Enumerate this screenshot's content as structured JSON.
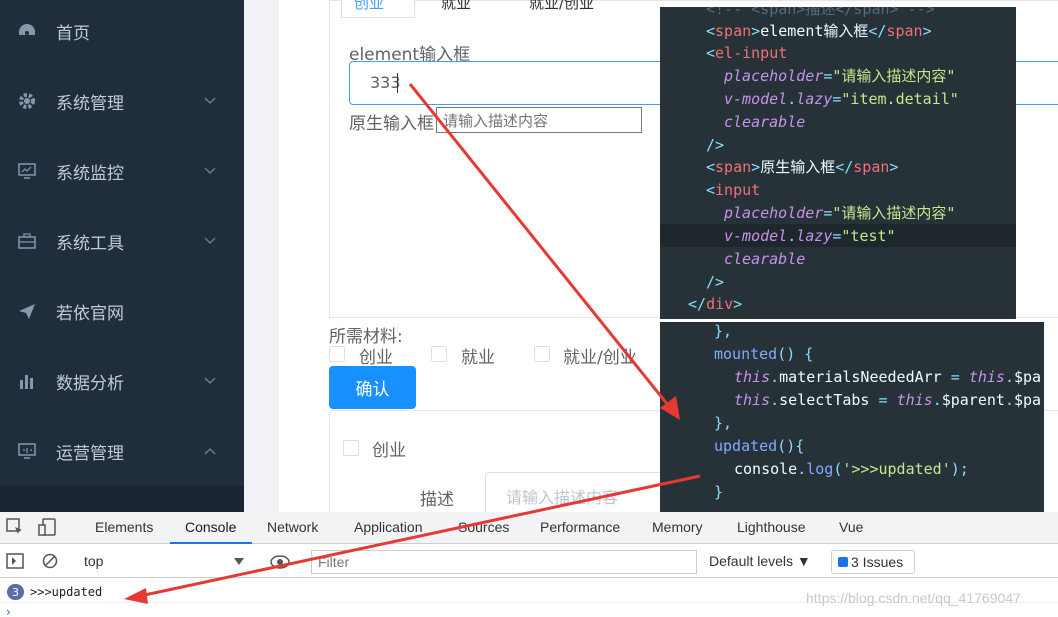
{
  "sidebar": {
    "items": [
      {
        "label": "首页",
        "icon": "dashboard-icon",
        "has_chevron": false
      },
      {
        "label": "系统管理",
        "icon": "gear-icon",
        "has_chevron": true
      },
      {
        "label": "系统监控",
        "icon": "monitor-icon",
        "has_chevron": true
      },
      {
        "label": "系统工具",
        "icon": "toolbox-icon",
        "has_chevron": true
      },
      {
        "label": "若依官网",
        "icon": "send-icon",
        "has_chevron": false
      },
      {
        "label": "数据分析",
        "icon": "bar-chart-icon",
        "has_chevron": true
      },
      {
        "label": "运营管理",
        "icon": "screen-icon",
        "has_chevron": true
      }
    ]
  },
  "tabs": [
    "创业",
    "就业",
    "就业/创业"
  ],
  "form": {
    "element_label": "element输入框",
    "element_value": "333",
    "native_label": "原生输入框",
    "native_placeholder": "请输入描述内容",
    "materials_label": "所需材料:",
    "checkboxes": [
      "创业",
      "就业",
      "就业/创业"
    ],
    "confirm_button": "确认",
    "section_checkbox": "创业",
    "desc_label": "描述",
    "desc_placeholder": "请输入描述内容"
  },
  "code_template": {
    "lines": [
      "<!-- <span>描述</span> -->",
      "<span>element输入框</span>",
      "<el-input",
      "placeholder=\"请输入描述内容\"",
      "v-model.lazy=\"item.detail\"",
      "clearable",
      "/>",
      "<span>原生输入框</span>",
      "<input",
      "placeholder=\"请输入描述内容\"",
      "v-model.lazy=\"test\"",
      "clearable",
      "/>",
      "</div>"
    ]
  },
  "code_script": {
    "lines": [
      "},",
      "mounted() {",
      "this.materialsNeededArr = this.$pa",
      "this.selectTabs = this.$parent.$pa",
      "},",
      "updated(){",
      "console.log('>>>updated');",
      "}"
    ]
  },
  "devtools": {
    "tabs": [
      "Elements",
      "Console",
      "Network",
      "Application",
      "Sources",
      "Performance",
      "Memory",
      "Lighthouse",
      "Vue"
    ],
    "active_tab": "Console",
    "context": "top",
    "filter_placeholder": "Filter",
    "levels": "Default levels ▼",
    "issues": "3 Issues",
    "log_count": "3",
    "log_text": ">>>updated",
    "watermark": "https://blog.csdn.net/qq_41769047"
  },
  "colors": {
    "accent": "#409eff",
    "sidebar_bg": "#1f2d3d",
    "button": "#1890ff",
    "annotation_arrow": "#e53935"
  }
}
